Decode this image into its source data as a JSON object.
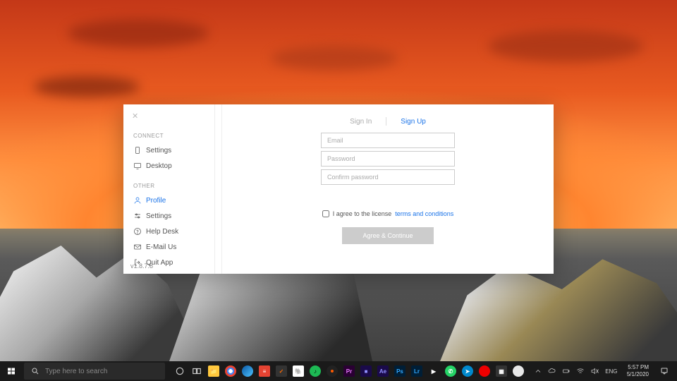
{
  "sidebar": {
    "connect_label": "CONNECT",
    "other_label": "OTHER",
    "connect_items": [
      {
        "label": "Settings",
        "icon": "phone"
      },
      {
        "label": "Desktop",
        "icon": "monitor"
      }
    ],
    "other_items": [
      {
        "label": "Profile",
        "icon": "user",
        "active": true
      },
      {
        "label": "Settings",
        "icon": "sliders"
      },
      {
        "label": "Help Desk",
        "icon": "help"
      },
      {
        "label": "E-Mail Us",
        "icon": "mail"
      },
      {
        "label": "Quit App",
        "icon": "exit"
      }
    ]
  },
  "version": "v1.8.7.8",
  "auth": {
    "signin_label": "Sign In",
    "signup_label": "Sign Up",
    "email_placeholder": "Email",
    "password_placeholder": "Password",
    "confirm_placeholder": "Confirm password",
    "agree_prefix": "I agree to the license",
    "agree_link": "terms and conditions",
    "submit_label": "Agree & Continue"
  },
  "taskbar": {
    "search_placeholder": "Type here to search"
  },
  "tray": {
    "time": "5:57 PM",
    "date": "5/1/2020"
  }
}
